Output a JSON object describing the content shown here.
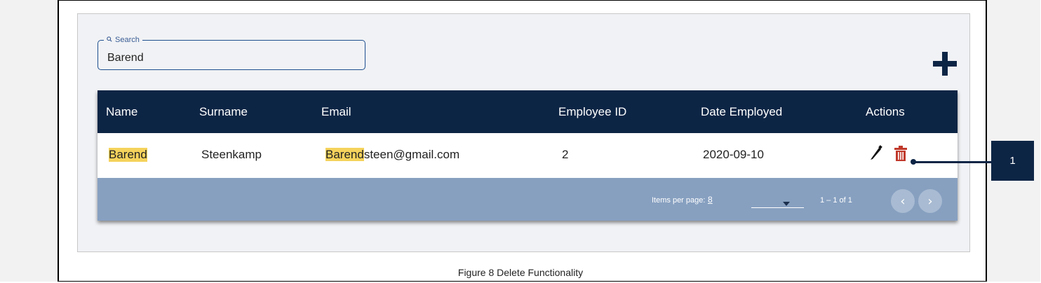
{
  "search": {
    "label": "Search",
    "value": "Barend"
  },
  "table": {
    "columns": [
      "Name",
      "Surname",
      "Email",
      "Employee ID",
      "Date Employed",
      "Actions"
    ],
    "rows": [
      {
        "name": "Barend",
        "surname": "Steenkamp",
        "email_highlight": "Barend",
        "email_rest": "steen@gmail.com",
        "employee_id": "2",
        "date_employed": "2020-09-10"
      }
    ]
  },
  "paginator": {
    "items_per_page_label": "Items per page:",
    "items_per_page_value": "8",
    "range": "1 – 1 of 1",
    "prev": "‹",
    "next": "›"
  },
  "callout": {
    "number": "1"
  },
  "caption": "Figure 8 Delete Functionality",
  "colors": {
    "header": "#0d2545",
    "paginator": "#87a0c0",
    "highlight": "#f5d35c",
    "delete": "#c0392b"
  }
}
